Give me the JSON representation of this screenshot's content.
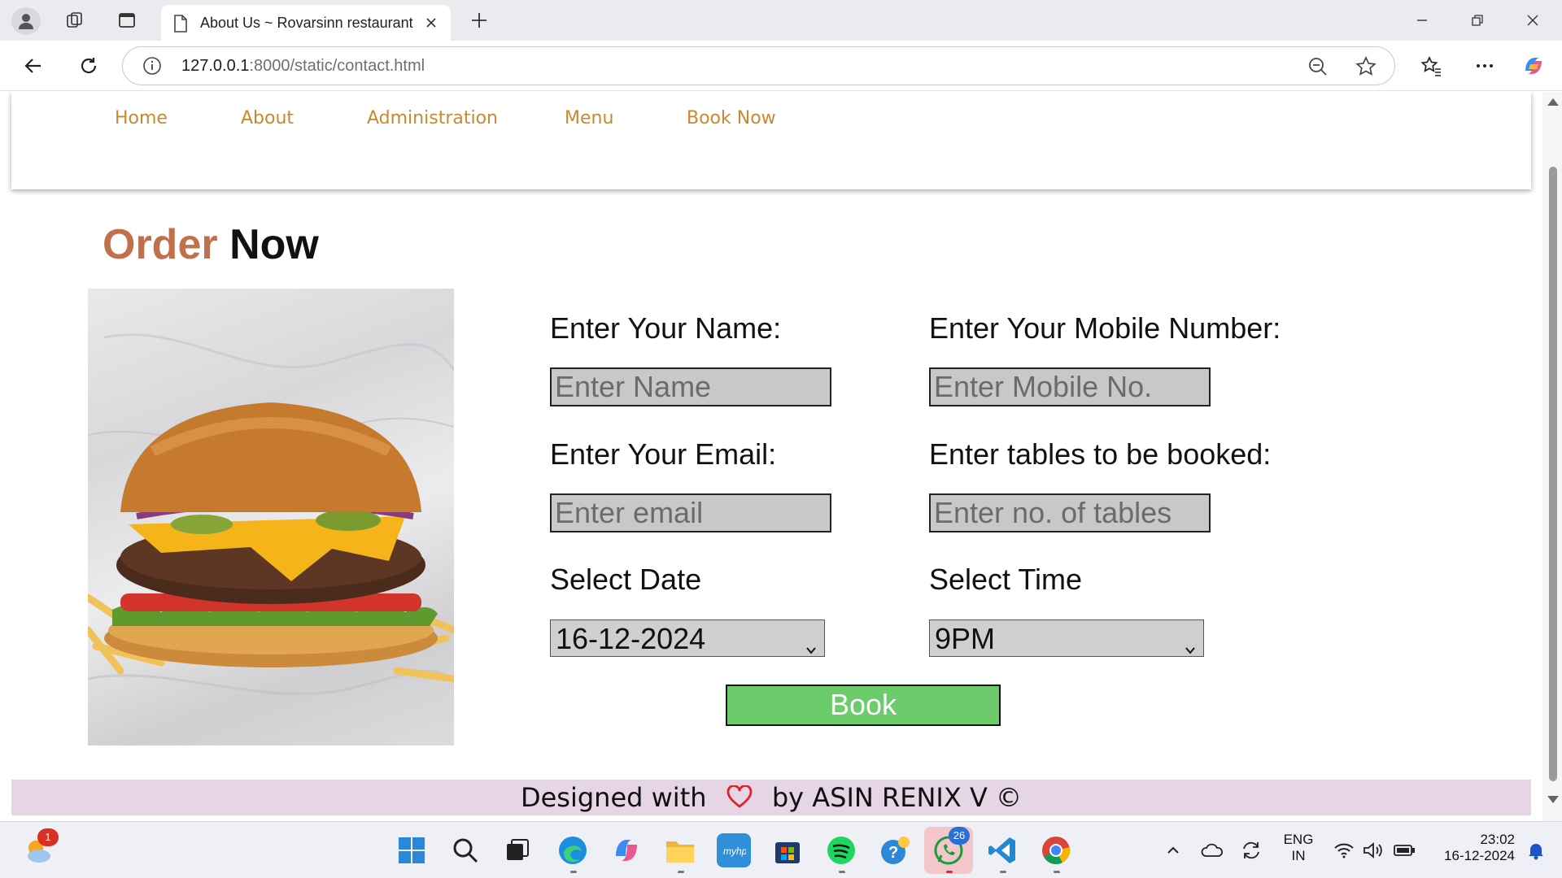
{
  "browser": {
    "tab_title": "About Us ~ Rovarsinn restaurant",
    "url_host": "127.0.0.1",
    "url_rest": ":8000/static/contact.html"
  },
  "site_nav": [
    "Home",
    "About",
    "Administration",
    "Menu",
    "Book Now"
  ],
  "heading": {
    "part1": "Order",
    "part2": "Now"
  },
  "form": {
    "name_label": "Enter Your Name:",
    "name_placeholder": "Enter Name",
    "mobile_label": "Enter Your Mobile Number:",
    "mobile_placeholder": "Enter Mobile No.",
    "email_label": "Enter Your Email:",
    "email_placeholder": "Enter email",
    "tables_label": "Enter tables to be booked:",
    "tables_placeholder": "Enter no. of tables",
    "date_label": "Select Date",
    "date_value": "16-12-2024",
    "time_label": "Select Time",
    "time_value": "9PM",
    "book_label": "Book"
  },
  "footer": {
    "before": "Designed with",
    "after": "by ASIN RENIX V ©"
  },
  "colors": {
    "brand_orange": "#c0714b",
    "nav_gold": "#c9892f",
    "button_green": "#6ccb6a",
    "footer_bg": "#e5d5e5"
  },
  "taskbar": {
    "weather_badge": "1",
    "whatsapp_badge": "26",
    "lang_line1": "ENG",
    "lang_line2": "IN",
    "time": "23:02",
    "date": "16-12-2024"
  }
}
